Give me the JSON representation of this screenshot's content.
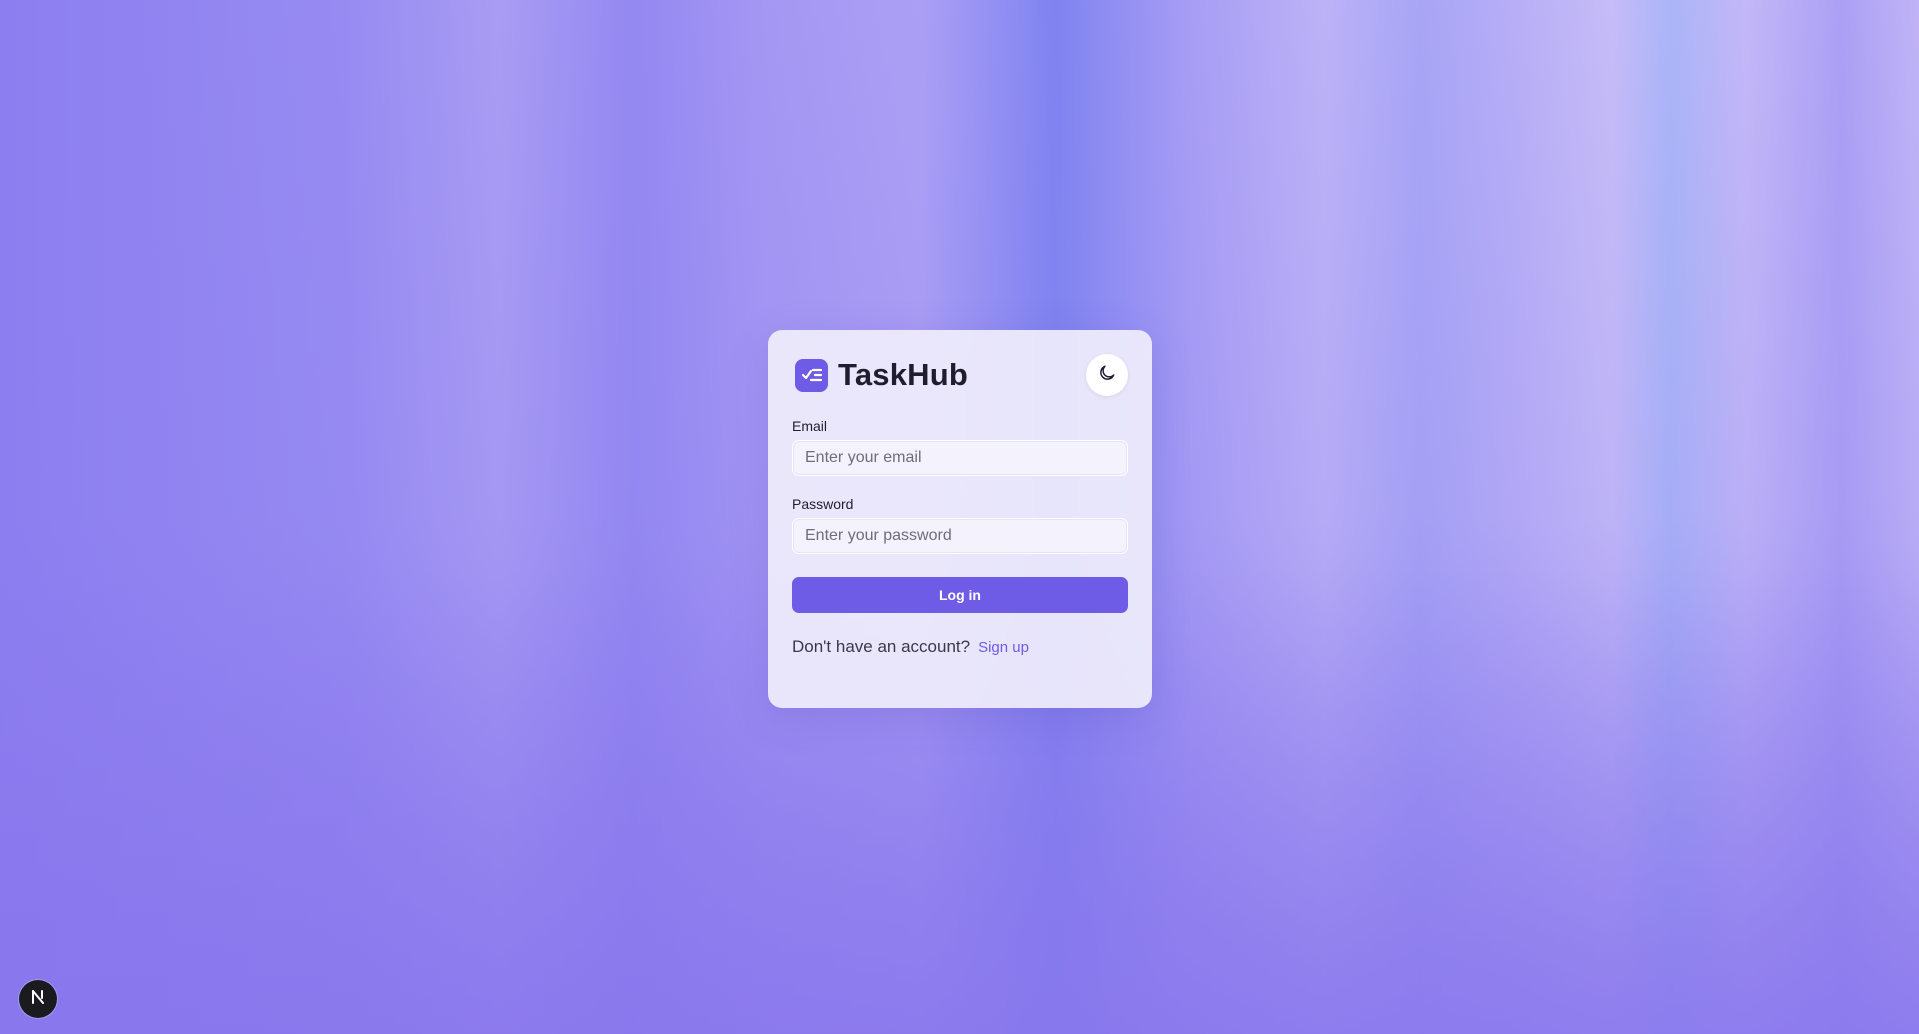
{
  "app": {
    "name": "TaskHub",
    "logo_icon": "checklist-icon",
    "theme_toggle_icon": "moon-icon"
  },
  "form": {
    "email_label": "Email",
    "email_placeholder": "Enter your email",
    "email_value": "",
    "password_label": "Password",
    "password_placeholder": "Enter your password",
    "password_value": "",
    "submit_label": "Log in"
  },
  "footer": {
    "prompt": "Don't have an account?",
    "link_label": "Sign up"
  },
  "dev_badge": {
    "icon": "nextjs-icon"
  },
  "colors": {
    "accent": "#6e5be6",
    "background": "#8b7cf0",
    "card": "#f0eefc"
  }
}
